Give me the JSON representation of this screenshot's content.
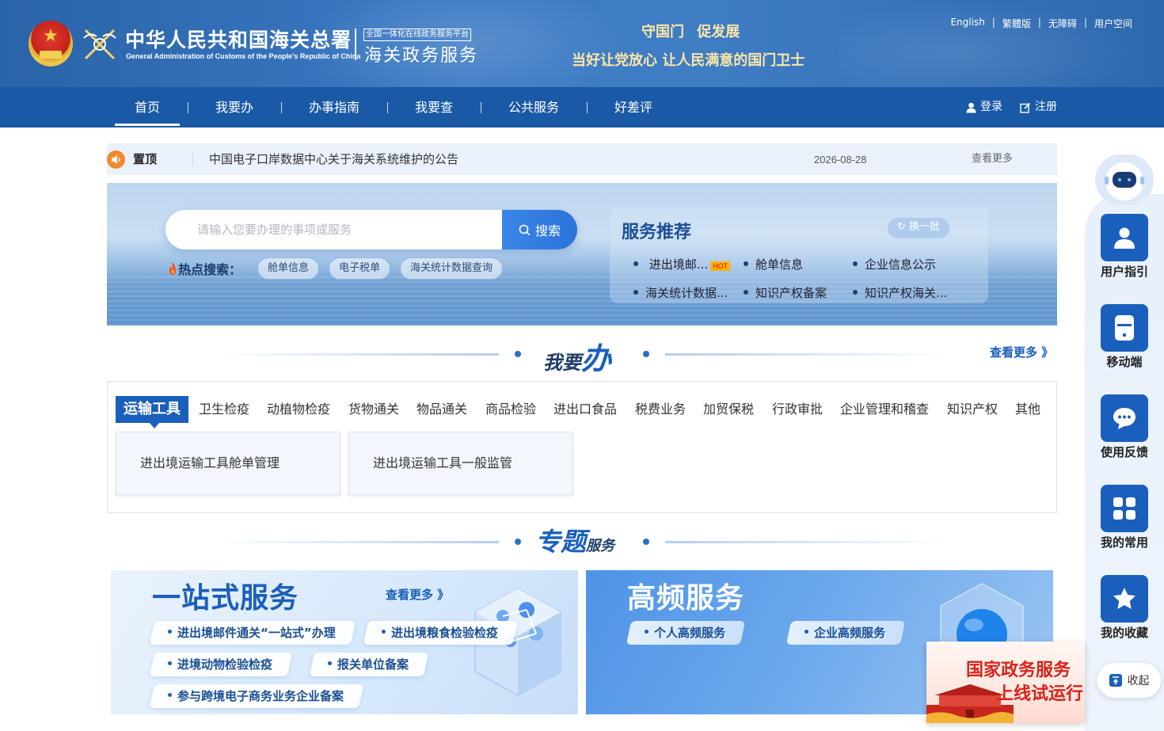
{
  "header": {
    "org_cn": "中华人民共和国海关总署",
    "org_en": "General Administration of Customs of the People's Republic of China",
    "platform_tag": "全国一体化在线政务服务平台",
    "platform_name": "海关政务服务",
    "slogan_line1": "守国门  促发展",
    "slogan_line2": "当好让党放心  让人民满意的国门卫士",
    "links": [
      "English",
      "繁體版",
      "无障碍",
      "用户空间"
    ]
  },
  "nav": {
    "items": [
      "首页",
      "我要办",
      "办事指南",
      "我要查",
      "公共服务",
      "好差评"
    ],
    "active": "首页",
    "login": "登录",
    "register": "注册"
  },
  "notice": {
    "label": "置顶",
    "text": "中国电子口岸数据中心关于海关系统维护的公告",
    "date": "2026-08-28",
    "more": "查看更多"
  },
  "search": {
    "placeholder": "请输入您要办理的事项或服务",
    "button": "搜索",
    "hot_title": "热点搜索：",
    "hot_items": [
      "舱单信息",
      "电子税单",
      "海关统计数据查询"
    ]
  },
  "recommend": {
    "title": "服务推荐",
    "refresh": "换一批",
    "hot_badge": "HOT",
    "items": [
      "进出境邮...",
      "舱单信息",
      "企业信息公示",
      "海关统计数据...",
      "知识产权备案",
      "知识产权海关..."
    ]
  },
  "woyaoban": {
    "title_a": "我要",
    "title_b": "办",
    "more": "查看更多 》",
    "tabs": [
      "运输工具",
      "卫生检疫",
      "动植物检疫",
      "货物通关",
      "物品通关",
      "商品检验",
      "进出口食品",
      "税费业务",
      "加贸保税",
      "行政审批",
      "企业管理和稽查",
      "知识产权",
      "其他"
    ],
    "active_tab": "运输工具",
    "cards": [
      "进出境运输工具舱单管理",
      "进出境运输工具一般监管"
    ]
  },
  "zhuanti": {
    "title_a": "专题",
    "title_b": "服务"
  },
  "onestop": {
    "title": "一站式服务",
    "more": "查看更多 》",
    "items": [
      "进出境邮件通关“一站式”办理",
      "进出境粮食检验检疫",
      "进境动物检验检疫",
      "报关单位备案",
      "参与跨境电子商务业务企业备案"
    ]
  },
  "highfreq": {
    "title": "高频服务",
    "items": [
      "个人高频服务",
      "企业高频服务"
    ]
  },
  "sidebar": {
    "items": [
      "用户指引",
      "移动端",
      "使用反馈",
      "我的常用",
      "我的收藏"
    ],
    "collapse": "收起"
  },
  "ad": {
    "line1": "国家政务服务",
    "line2": "上线试运行"
  },
  "colors": {
    "header_blue": "#2a63a8",
    "nav_blue": "#1a59a5",
    "accent_blue": "#1a5fbb",
    "slogan_gold": "#fde7a4",
    "notice_orange": "#f08a2c",
    "ad_red": "#d7231b"
  },
  "icons": [
    "national-emblem-icon",
    "customs-emblem-icon",
    "user-icon",
    "edit-icon",
    "speaker-icon",
    "search-icon",
    "refresh-icon",
    "fire-icon",
    "robot-icon",
    "person-icon",
    "mobile-icon",
    "chat-icon",
    "grid-icon",
    "star-icon",
    "collapse-up-icon"
  ]
}
